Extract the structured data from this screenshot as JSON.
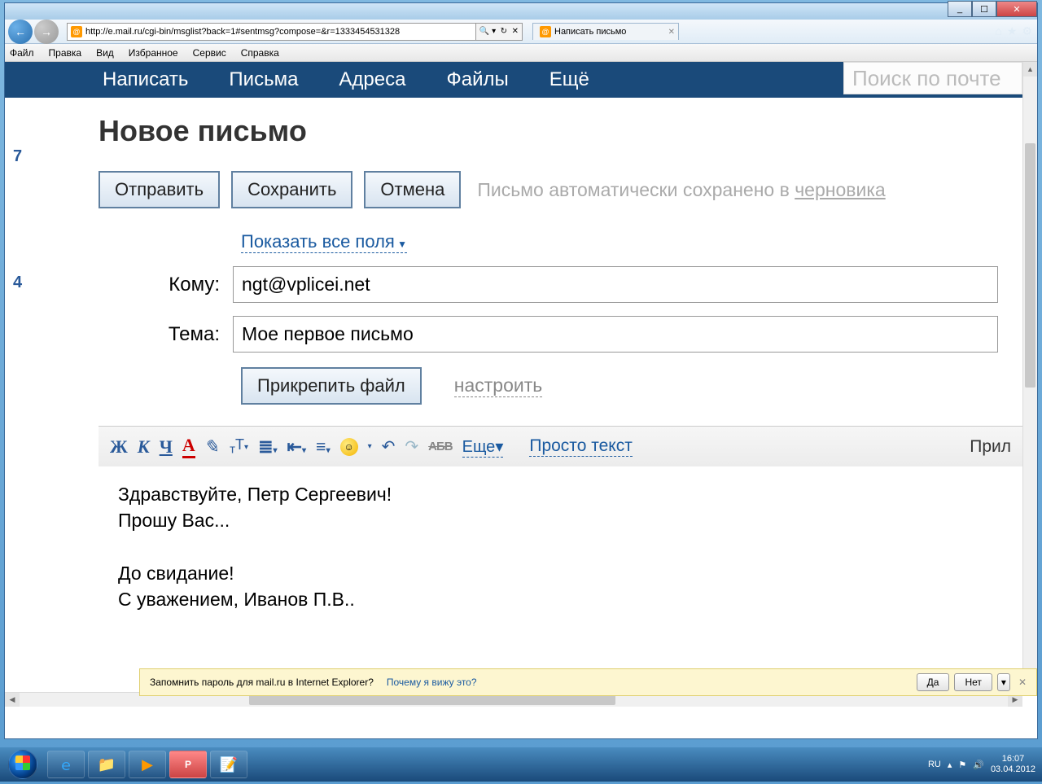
{
  "browser": {
    "url": "http://e.mail.ru/cgi-bin/msglist?back=1#sentmsg?compose=&r=1333454531328",
    "tab_title": "Написать письмо",
    "menus": {
      "file": "Файл",
      "edit": "Правка",
      "view": "Вид",
      "favorites": "Избранное",
      "service": "Сервис",
      "help": "Справка"
    }
  },
  "mailnav": {
    "compose": "Написать",
    "letters": "Письма",
    "contacts": "Адреса",
    "files": "Файлы",
    "more": "Ещё",
    "search_placeholder": "Поиск по почте"
  },
  "sidebar": {
    "num1": "7",
    "num2": "4"
  },
  "compose": {
    "title": "Новое письмо",
    "send": "Отправить",
    "save": "Сохранить",
    "cancel": "Отмена",
    "autosave_prefix": "Письмо автоматически сохранено в ",
    "autosave_drafts": "черновика",
    "show_all_fields": "Показать все поля",
    "to_label": "Кому:",
    "to_value": "ngt@vplicei.net",
    "subject_label": "Тема:",
    "subject_value": "Мое первое письмо",
    "attach": "Прикрепить файл",
    "configure": "настроить"
  },
  "richtext": {
    "bold": "Ж",
    "italic": "К",
    "underline": "Ч",
    "more": "Еще",
    "plain": "Просто текст",
    "right_label": "Прил",
    "strike": "АБВ"
  },
  "body": {
    "l1": "Здравствуйте, Петр Сергеевич!",
    "l2": "Прошу Вас...",
    "l3": "До свидание!",
    "l4": "С уважением, Иванов П.В.."
  },
  "infobar": {
    "text": "Запомнить пароль для mail.ru в Internet Explorer?",
    "why": "Почему я вижу это?",
    "yes": "Да",
    "no": "Нет"
  },
  "tray": {
    "lang": "RU",
    "time": "16:07",
    "date": "03.04.2012"
  }
}
